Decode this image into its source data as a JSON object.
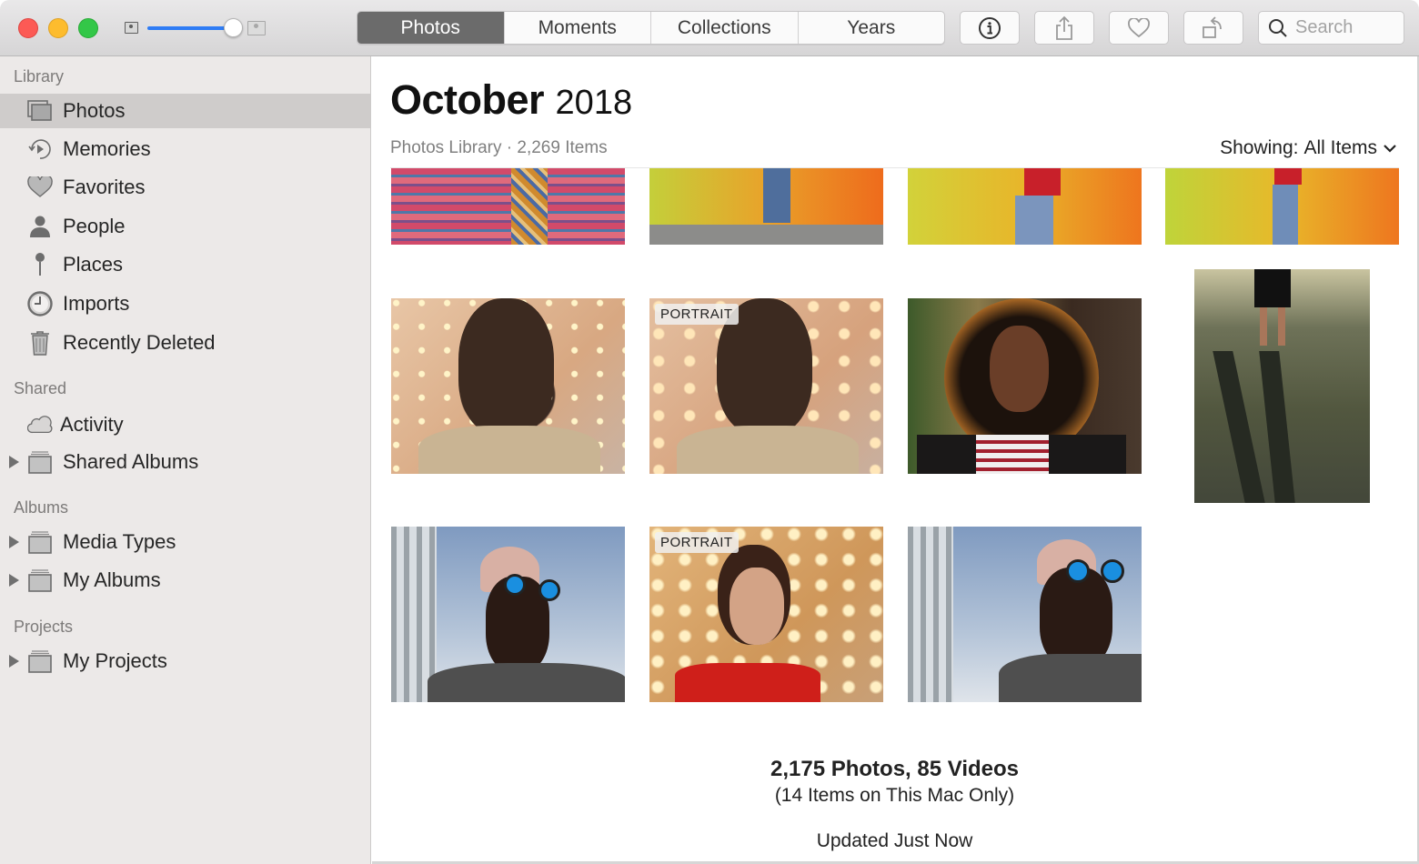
{
  "window": {
    "traffic_lights": [
      "close",
      "minimize",
      "zoom"
    ],
    "thumbnail_size_slider": {
      "value_fraction": 0.9
    }
  },
  "toolbar": {
    "tabs": [
      {
        "label": "Photos",
        "active": true
      },
      {
        "label": "Moments",
        "active": false
      },
      {
        "label": "Collections",
        "active": false
      },
      {
        "label": "Years",
        "active": false
      }
    ],
    "buttons": [
      {
        "name": "info",
        "icon": "info-icon"
      },
      {
        "name": "share",
        "icon": "share-icon"
      },
      {
        "name": "favorite",
        "icon": "heart-icon"
      },
      {
        "name": "rotate",
        "icon": "rotate-icon"
      }
    ],
    "search": {
      "placeholder": "Search",
      "value": ""
    }
  },
  "sidebar": {
    "sections": [
      {
        "header": "Library",
        "items": [
          {
            "label": "Photos",
            "icon": "photos-icon",
            "selected": true
          },
          {
            "label": "Memories",
            "icon": "memories-icon"
          },
          {
            "label": "Favorites",
            "icon": "heart-icon"
          },
          {
            "label": "People",
            "icon": "person-icon"
          },
          {
            "label": "Places",
            "icon": "pin-icon"
          },
          {
            "label": "Imports",
            "icon": "clock-icon"
          },
          {
            "label": "Recently Deleted",
            "icon": "trash-icon"
          }
        ]
      },
      {
        "header": "Shared",
        "items": [
          {
            "label": "Activity",
            "icon": "cloud-icon"
          },
          {
            "label": "Shared Albums",
            "icon": "album-stack-icon",
            "expandable": true
          }
        ]
      },
      {
        "header": "Albums",
        "items": [
          {
            "label": "Media Types",
            "icon": "album-stack-icon",
            "expandable": true
          },
          {
            "label": "My Albums",
            "icon": "album-stack-icon",
            "expandable": true
          }
        ]
      },
      {
        "header": "Projects",
        "items": [
          {
            "label": "My Projects",
            "icon": "album-stack-icon",
            "expandable": true
          }
        ]
      }
    ]
  },
  "main": {
    "title_month": "October",
    "title_year": "2018",
    "subtitle": "Photos Library · 2,269 Items",
    "showing_label": "Showing:",
    "showing_value": "All Items",
    "photos": [
      {
        "id": "p1",
        "desc": "striped wall, patterned dress"
      },
      {
        "id": "p2",
        "desc": "yellow-orange brick wall, jeans"
      },
      {
        "id": "p3",
        "desc": "yellow-orange brick wall, red shirt"
      },
      {
        "id": "p4",
        "desc": "green-orange brick wall, jeans"
      },
      {
        "id": "p5",
        "desc": "man with glasses, lights background"
      },
      {
        "id": "p6",
        "desc": "man with glasses, portrait",
        "badge": "PORTRAIT"
      },
      {
        "id": "p7",
        "desc": "woman with curly hair, backlit"
      },
      {
        "id": "p8",
        "desc": "shadows on grass"
      },
      {
        "id": "p9",
        "desc": "man in blue sunglasses"
      },
      {
        "id": "p10",
        "desc": "woman with braid, portrait",
        "badge": "PORTRAIT"
      },
      {
        "id": "p11",
        "desc": "man in blue sunglasses smiling"
      }
    ],
    "summary_counts": "2,175 Photos, 85 Videos",
    "summary_local": "(14 Items on This Mac Only)",
    "summary_status": "Updated Just Now"
  },
  "colors": {
    "accent": "#2f7cf5",
    "sidebar_bg": "#ece9e8",
    "selected_row": "#cfcccb",
    "active_tab": "#6b6b6b"
  }
}
